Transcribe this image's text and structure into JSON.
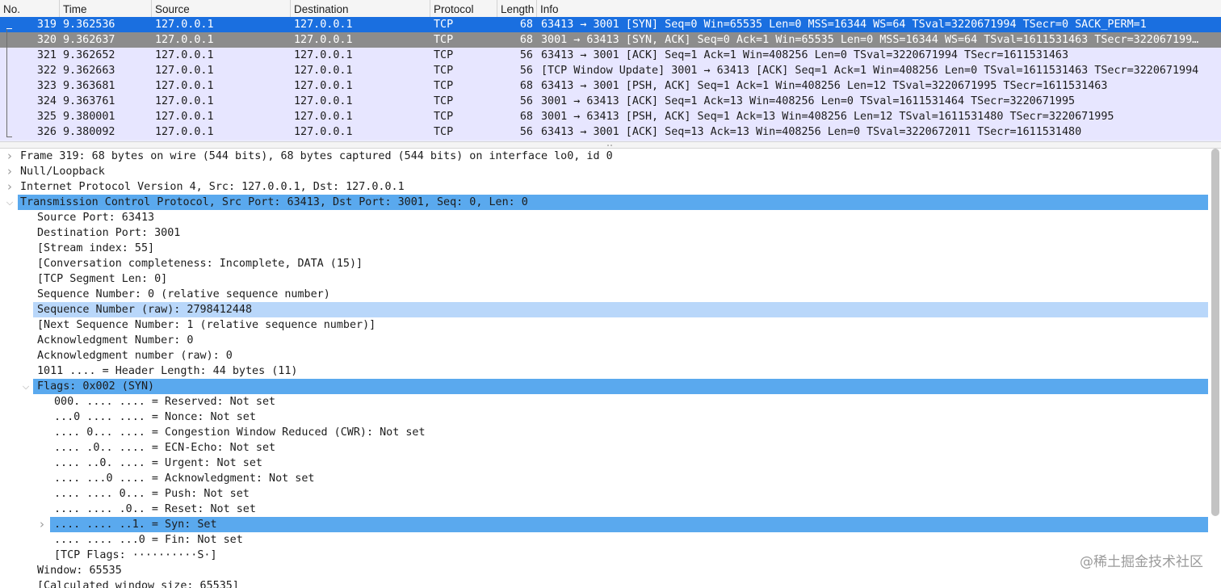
{
  "packet_list": {
    "columns": [
      "No.",
      "Time",
      "Source",
      "Destination",
      "Protocol",
      "Length",
      "Info"
    ],
    "rows": [
      {
        "no": "319",
        "time": "9.362536",
        "source": "127.0.0.1",
        "destination": "127.0.0.1",
        "protocol": "TCP",
        "length": "68",
        "info": "63413 → 3001 [SYN] Seq=0 Win=65535 Len=0 MSS=16344 WS=64 TSval=3220671994 TSecr=0 SACK_PERM=1"
      },
      {
        "no": "320",
        "time": "9.362637",
        "source": "127.0.0.1",
        "destination": "127.0.0.1",
        "protocol": "TCP",
        "length": "68",
        "info": "3001 → 63413 [SYN, ACK] Seq=0 Ack=1 Win=65535 Len=0 MSS=16344 WS=64 TSval=1611531463 TSecr=322067199…"
      },
      {
        "no": "321",
        "time": "9.362652",
        "source": "127.0.0.1",
        "destination": "127.0.0.1",
        "protocol": "TCP",
        "length": "56",
        "info": "63413 → 3001 [ACK] Seq=1 Ack=1 Win=408256 Len=0 TSval=3220671994 TSecr=1611531463"
      },
      {
        "no": "322",
        "time": "9.362663",
        "source": "127.0.0.1",
        "destination": "127.0.0.1",
        "protocol": "TCP",
        "length": "56",
        "info": "[TCP Window Update] 3001 → 63413 [ACK] Seq=1 Ack=1 Win=408256 Len=0 TSval=1611531463 TSecr=3220671994"
      },
      {
        "no": "323",
        "time": "9.363681",
        "source": "127.0.0.1",
        "destination": "127.0.0.1",
        "protocol": "TCP",
        "length": "68",
        "info": "63413 → 3001 [PSH, ACK] Seq=1 Ack=1 Win=408256 Len=12 TSval=3220671995 TSecr=1611531463"
      },
      {
        "no": "324",
        "time": "9.363761",
        "source": "127.0.0.1",
        "destination": "127.0.0.1",
        "protocol": "TCP",
        "length": "56",
        "info": "3001 → 63413 [ACK] Seq=1 Ack=13 Win=408256 Len=0 TSval=1611531464 TSecr=3220671995"
      },
      {
        "no": "325",
        "time": "9.380001",
        "source": "127.0.0.1",
        "destination": "127.0.0.1",
        "protocol": "TCP",
        "length": "68",
        "info": "3001 → 63413 [PSH, ACK] Seq=1 Ack=13 Win=408256 Len=12 TSval=1611531480 TSecr=3220671995"
      },
      {
        "no": "326",
        "time": "9.380092",
        "source": "127.0.0.1",
        "destination": "127.0.0.1",
        "protocol": "TCP",
        "length": "56",
        "info": "63413 → 3001 [ACK] Seq=13 Ack=13 Win=408256 Len=0 TSval=3220672011 TSecr=1611531480"
      }
    ],
    "selected_index": 0,
    "related_index": 1
  },
  "details": {
    "rows": [
      {
        "text": "Frame 319: 68 bytes on wire (544 bits), 68 bytes captured (544 bits) on interface lo0, id 0",
        "level": 0,
        "expander": "collapsed",
        "highlight": "none"
      },
      {
        "text": "Null/Loopback",
        "level": 0,
        "expander": "collapsed",
        "highlight": "none"
      },
      {
        "text": "Internet Protocol Version 4, Src: 127.0.0.1, Dst: 127.0.0.1",
        "level": 0,
        "expander": "collapsed",
        "highlight": "none"
      },
      {
        "text": "Transmission Control Protocol, Src Port: 63413, Dst Port: 3001, Seq: 0, Len: 0",
        "level": 0,
        "expander": "expanded",
        "highlight": "blue"
      },
      {
        "text": "Source Port: 63413",
        "level": 1,
        "expander": "none",
        "highlight": "none"
      },
      {
        "text": "Destination Port: 3001",
        "level": 1,
        "expander": "none",
        "highlight": "none"
      },
      {
        "text": "[Stream index: 55]",
        "level": 1,
        "expander": "none",
        "highlight": "none"
      },
      {
        "text": "[Conversation completeness: Incomplete, DATA (15)]",
        "level": 1,
        "expander": "none",
        "highlight": "none"
      },
      {
        "text": "[TCP Segment Len: 0]",
        "level": 1,
        "expander": "none",
        "highlight": "none"
      },
      {
        "text": "Sequence Number: 0    (relative sequence number)",
        "level": 1,
        "expander": "none",
        "highlight": "none"
      },
      {
        "text": "Sequence Number (raw): 2798412448",
        "level": 1,
        "expander": "none",
        "highlight": "light"
      },
      {
        "text": "[Next Sequence Number: 1    (relative sequence number)]",
        "level": 1,
        "expander": "none",
        "highlight": "none"
      },
      {
        "text": "Acknowledgment Number: 0",
        "level": 1,
        "expander": "none",
        "highlight": "none"
      },
      {
        "text": "Acknowledgment number (raw): 0",
        "level": 1,
        "expander": "none",
        "highlight": "none"
      },
      {
        "text": "1011 .... = Header Length: 44 bytes (11)",
        "level": 1,
        "expander": "none",
        "highlight": "none"
      },
      {
        "text": "Flags: 0x002 (SYN)",
        "level": 1,
        "expander": "expanded",
        "highlight": "blue"
      },
      {
        "text": "000. .... .... = Reserved: Not set",
        "level": 2,
        "expander": "none",
        "highlight": "none"
      },
      {
        "text": "...0 .... .... = Nonce: Not set",
        "level": 2,
        "expander": "none",
        "highlight": "none"
      },
      {
        "text": ".... 0... .... = Congestion Window Reduced (CWR): Not set",
        "level": 2,
        "expander": "none",
        "highlight": "none"
      },
      {
        "text": ".... .0.. .... = ECN-Echo: Not set",
        "level": 2,
        "expander": "none",
        "highlight": "none"
      },
      {
        "text": ".... ..0. .... = Urgent: Not set",
        "level": 2,
        "expander": "none",
        "highlight": "none"
      },
      {
        "text": ".... ...0 .... = Acknowledgment: Not set",
        "level": 2,
        "expander": "none",
        "highlight": "none"
      },
      {
        "text": ".... .... 0... = Push: Not set",
        "level": 2,
        "expander": "none",
        "highlight": "none"
      },
      {
        "text": ".... .... .0.. = Reset: Not set",
        "level": 2,
        "expander": "none",
        "highlight": "none"
      },
      {
        "text": ".... .... ..1. = Syn: Set",
        "level": 2,
        "expander": "collapsed",
        "highlight": "blue"
      },
      {
        "text": ".... .... ...0 = Fin: Not set",
        "level": 2,
        "expander": "none",
        "highlight": "none"
      },
      {
        "text": "[TCP Flags: ··········S·]",
        "level": 2,
        "expander": "none",
        "highlight": "none"
      },
      {
        "text": "Window: 65535",
        "level": 1,
        "expander": "none",
        "highlight": "none"
      },
      {
        "text": "[Calculated window size: 65535]",
        "level": 1,
        "expander": "none",
        "highlight": "none"
      }
    ]
  },
  "watermark": "@稀土掘金技术社区",
  "colors": {
    "selected_row": "#1a6fe0",
    "related_row": "#8c8c8c",
    "tcp_row_bg": "#e7e6ff",
    "detail_highlight": "#5aa9ee",
    "detail_highlight_light": "#b9d7fa"
  }
}
